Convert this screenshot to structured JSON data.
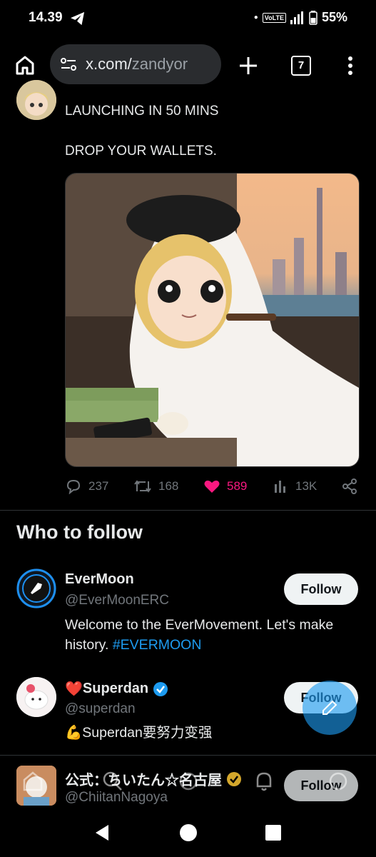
{
  "status_bar": {
    "time": "14.39",
    "volte": "VoLTE",
    "battery": "55%"
  },
  "browser": {
    "url_domain": "x.com/",
    "url_path": "zandyor",
    "tab_count": "7"
  },
  "tweet": {
    "line1": "LAUNCHING IN 50 MINS",
    "line2": "DROP YOUR WALLETS.",
    "actions": {
      "replies": "237",
      "retweets": "168",
      "likes": "589",
      "views": "13K"
    },
    "like_color": "#f91880"
  },
  "who_to_follow": {
    "title": "Who to follow",
    "follow_label": "Follow",
    "users": [
      {
        "name": "EverMoon",
        "handle": "@EverMoonERC",
        "bio": "Welcome to the EverMovement. Let's make history.",
        "hashtag": "#EVERMOON"
      },
      {
        "name_prefix": "❤️",
        "name": "Superdan",
        "verified": true,
        "handle": "@superdan",
        "bio": "💪Superdan要努力变强"
      },
      {
        "name": "公式：ちいたん☆名古屋",
        "verified_gold": true,
        "handle": "@ChiitanNagoya"
      }
    ]
  },
  "colors": {
    "accent": "#1d9bf0",
    "background": "#000000",
    "text": "#e7e9ea",
    "muted": "#71767b"
  },
  "icons": [
    "telegram-icon",
    "signal-icon",
    "battery-icon",
    "home-icon",
    "site-settings-icon",
    "plus-icon",
    "more-vert-icon",
    "reply-icon",
    "retweet-icon",
    "heart-icon",
    "views-icon",
    "share-icon",
    "verified-badge-icon",
    "compose-icon",
    "search-icon",
    "bell-icon",
    "back-icon",
    "home-circle-icon",
    "recents-icon"
  ]
}
